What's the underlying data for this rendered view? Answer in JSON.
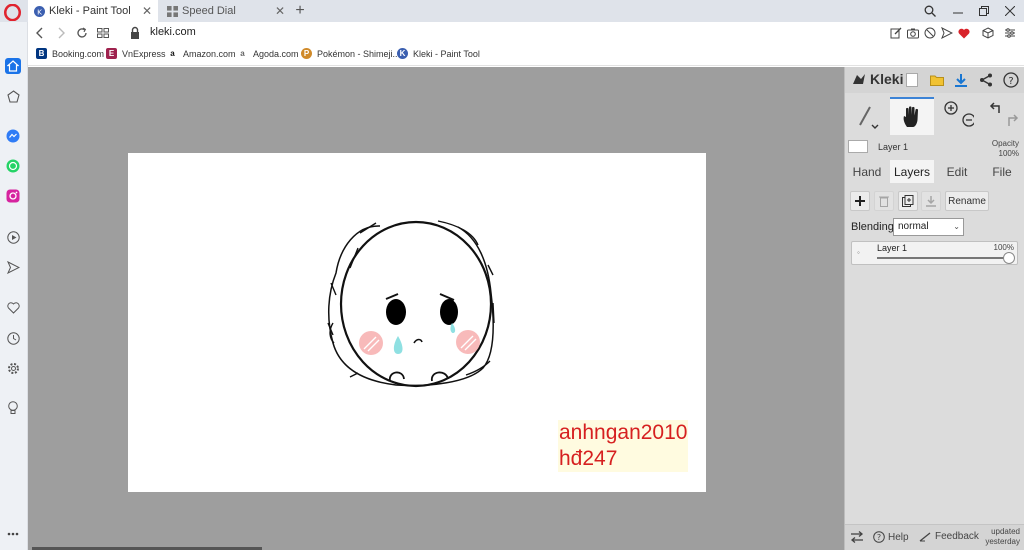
{
  "browser": {
    "tabs": [
      {
        "title": "Kleki - Paint Tool",
        "active": true
      },
      {
        "title": "Speed Dial",
        "active": false
      }
    ],
    "new_tab": "+",
    "close_glyph": "✕",
    "url": "kleki.com",
    "bookmarks": [
      {
        "label": "Booking.com",
        "icon": "B",
        "color": "#003580"
      },
      {
        "label": "VnExpress",
        "icon": "E",
        "color": "#9f224e"
      },
      {
        "label": "Amazon.com",
        "icon": "a",
        "color": "#111111"
      },
      {
        "label": "Agoda.com",
        "icon": "a",
        "color": "#666666"
      },
      {
        "label": "Pokémon - Shimeji...",
        "icon": "P",
        "color": "#d08a2a"
      },
      {
        "label": "Kleki - Paint Tool",
        "icon": "K",
        "color": "#3b5fb0"
      }
    ],
    "sidebar_icons": [
      "home-icon",
      "pin-icon",
      "messenger-icon",
      "whatsapp-icon",
      "instagram-icon",
      "player-icon",
      "send-icon",
      "heart-icon",
      "history-icon",
      "settings-icon",
      "lightbulb-icon",
      "more-icon"
    ],
    "accent": "#1a73e8"
  },
  "canvas": {
    "watermark_line1": "anhngan2010",
    "watermark_line2": "hđ247",
    "watermark_color": "#d62020"
  },
  "kleki": {
    "logo": "Kleki",
    "layer_name": "Layer 1",
    "opacity_label": "Opacity",
    "opacity_value": "100%",
    "tabs": [
      "Hand",
      "Layers",
      "Edit",
      "File"
    ],
    "active_tab": "Layers",
    "rename_label": "Rename",
    "blending_label": "Blending",
    "blending_value": "normal",
    "layers": [
      {
        "name": "Layer 1",
        "opacity": "100%",
        "opacity_fraction": 1.0
      }
    ],
    "footer": {
      "help": "Help",
      "feedback": "Feedback",
      "updated_line1": "updated",
      "updated_line2": "yesterday"
    },
    "selected_tool": "hand"
  }
}
